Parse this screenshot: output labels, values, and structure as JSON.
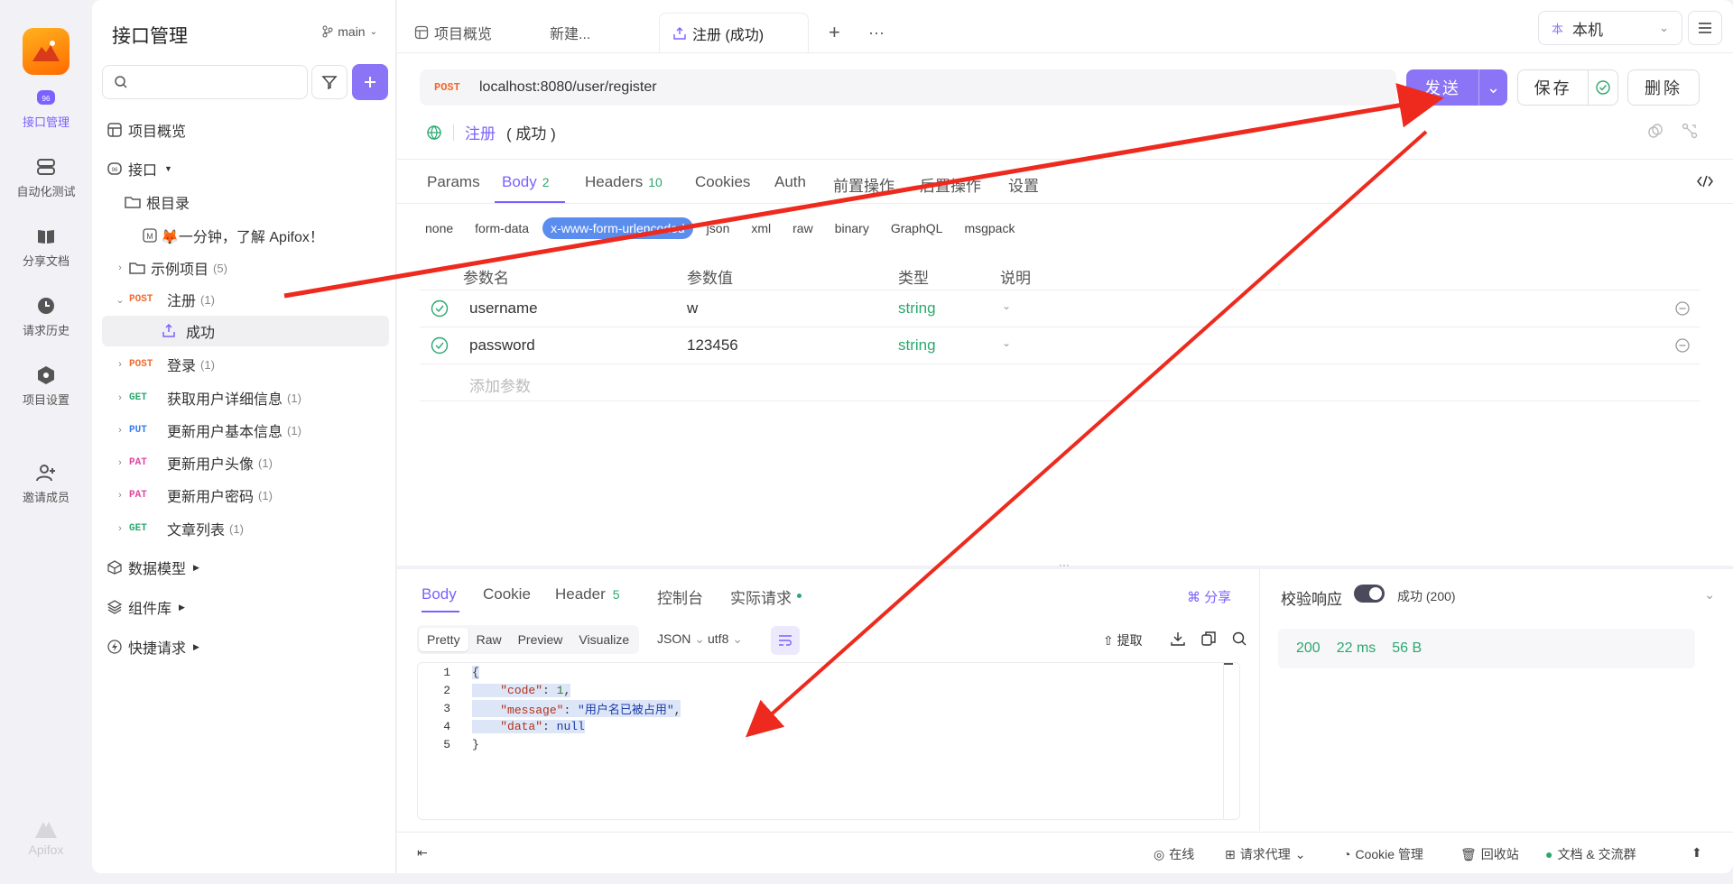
{
  "rail": {
    "items": [
      {
        "label": "接口管理",
        "icon": "api-icon",
        "active": true
      },
      {
        "label": "自动化测试",
        "icon": "automation-icon"
      },
      {
        "label": "分享文档",
        "icon": "book-icon"
      },
      {
        "label": "请求历史",
        "icon": "clock-icon"
      },
      {
        "label": "项目设置",
        "icon": "settings-hex-icon"
      },
      {
        "label": "邀请成员",
        "icon": "add-user-icon"
      }
    ],
    "brand": "Apifox"
  },
  "sidebar": {
    "title": "接口管理",
    "branch": "main",
    "search_placeholder": "",
    "tree": [
      {
        "label": "项目概览"
      },
      {
        "label": "接口"
      },
      {
        "label": "根目录"
      },
      {
        "label": "🦊一分钟，了解 Apifox！"
      },
      {
        "label": "示例项目",
        "count": "(5)"
      },
      {
        "method": "POST",
        "label": "注册",
        "count": "(1)"
      },
      {
        "label": "成功"
      },
      {
        "method": "POST",
        "label": "登录",
        "count": "(1)"
      },
      {
        "method": "GET",
        "label": "获取用户详细信息",
        "count": "(1)"
      },
      {
        "method": "PUT",
        "label": "更新用户基本信息",
        "count": "(1)"
      },
      {
        "method": "PAT",
        "label": "更新用户头像",
        "count": "(1)"
      },
      {
        "method": "PAT",
        "label": "更新用户密码",
        "count": "(1)"
      },
      {
        "method": "GET",
        "label": "文章列表",
        "count": "(1)"
      },
      {
        "label": "数据模型"
      },
      {
        "label": "组件库"
      },
      {
        "label": "快捷请求"
      }
    ]
  },
  "tabs": [
    {
      "label": "项目概览"
    },
    {
      "label": "新建..."
    },
    {
      "label": "注册 (成功)",
      "active": true
    }
  ],
  "env": {
    "label": "本机",
    "badge": "本"
  },
  "request": {
    "method": "POST",
    "url": "localhost:8080/user/register",
    "send_label": "发送",
    "save_label": "保存",
    "delete_label": "删除",
    "name": "注册",
    "status": "( 成功 )"
  },
  "subtabs": [
    {
      "label": "Params"
    },
    {
      "label": "Body",
      "badge": "2",
      "active": true
    },
    {
      "label": "Headers",
      "badge": "10"
    },
    {
      "label": "Cookies"
    },
    {
      "label": "Auth"
    },
    {
      "label": "前置操作"
    },
    {
      "label": "后置操作"
    },
    {
      "label": "设置"
    }
  ],
  "body_types": [
    "none",
    "form-data",
    "x-www-form-urlencoded",
    "json",
    "xml",
    "raw",
    "binary",
    "GraphQL",
    "msgpack"
  ],
  "params": {
    "headers": [
      "参数名",
      "参数值",
      "类型",
      "说明"
    ],
    "rows": [
      {
        "name": "username",
        "value": "w",
        "type": "string",
        "desc": ""
      },
      {
        "name": "password",
        "value": "123456",
        "type": "string",
        "desc": ""
      }
    ],
    "add_placeholder": "添加参数"
  },
  "response": {
    "tabs": [
      {
        "label": "Body",
        "active": true
      },
      {
        "label": "Cookie"
      },
      {
        "label": "Header",
        "badge": "5"
      },
      {
        "label": "控制台"
      },
      {
        "label": "实际请求"
      }
    ],
    "share": "分享",
    "formats": [
      "Pretty",
      "Raw",
      "Preview",
      "Visualize"
    ],
    "lang": "JSON",
    "encoding": "utf8",
    "extract": "提取",
    "code_lines": [
      {
        "n": "1",
        "text": "{"
      },
      {
        "n": "2",
        "key": "\"code\"",
        "val": "1",
        "vt": "n",
        "comma": ","
      },
      {
        "n": "3",
        "key": "\"message\"",
        "val": "\"用户名已被占用\"",
        "vt": "s",
        "comma": ","
      },
      {
        "n": "4",
        "key": "\"data\"",
        "val": "null",
        "vt": "nul",
        "comma": ""
      },
      {
        "n": "5",
        "text": "}"
      }
    ]
  },
  "verify": {
    "title": "校验响应",
    "status": "成功 (200)",
    "code": "200",
    "time": "22 ms",
    "size": "56 B"
  },
  "statusbar": {
    "online": "在线",
    "proxy": "请求代理",
    "cookie": "Cookie 管理",
    "trash": "回收站",
    "docs": "文档 & 交流群"
  },
  "colors": {
    "accent": "#7b61ff",
    "post": "#f06b2e",
    "get": "#2aa86e",
    "put": "#3a7de8",
    "pat": "#e0469e",
    "arrow": "#ee2a1e"
  }
}
